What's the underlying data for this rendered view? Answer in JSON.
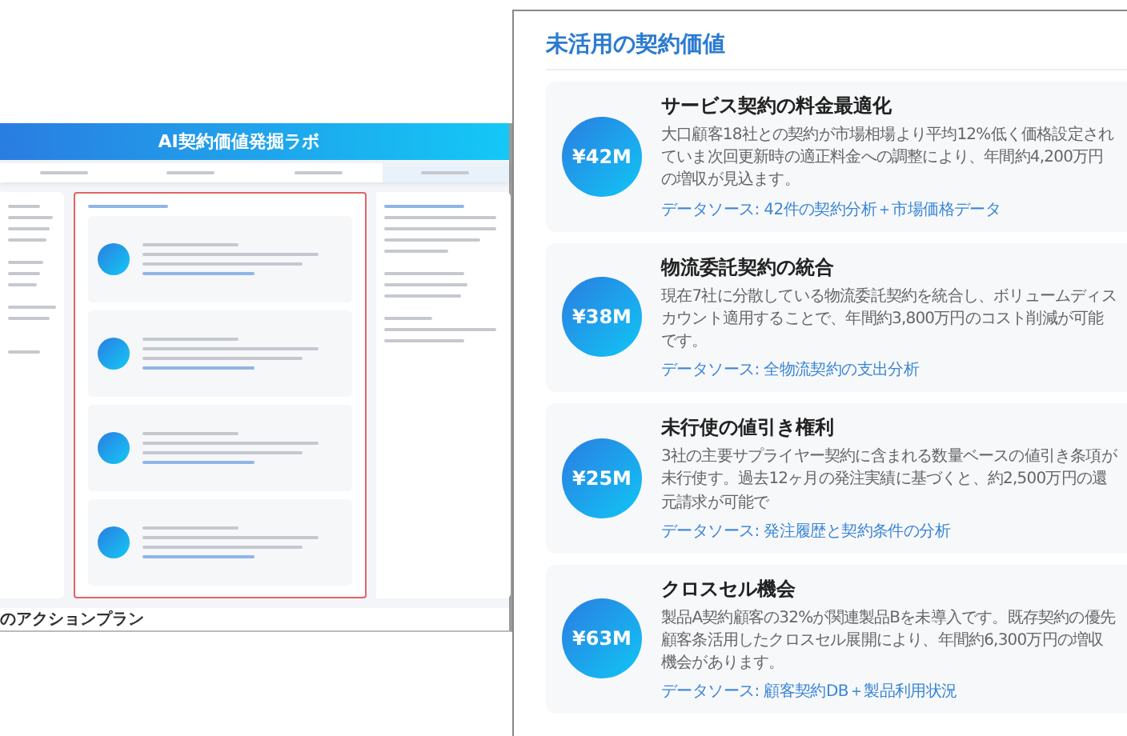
{
  "thumbnail": {
    "title": "AI契約価値発掘ラボ",
    "footer_heading": "のアクションプラン"
  },
  "panel": {
    "heading": "未活用の契約価値",
    "cards": [
      {
        "amount": "¥42M",
        "title": "サービス契約の料金最適化",
        "body": "大口顧客18社との契約が市場相場より平均12%低く価格設定されていま次回更新時の適正料金への調整により、年間約4,200万円の増収が見込ます。",
        "source": "データソース: 42件の契約分析＋市場価格データ"
      },
      {
        "amount": "¥38M",
        "title": "物流委託契約の統合",
        "body": "現在7社に分散している物流委託契約を統合し、ボリュームディスカウント適用することで、年間約3,800万円のコスト削減が可能です。",
        "source": "データソース: 全物流契約の支出分析"
      },
      {
        "amount": "¥25M",
        "title": "未行使の値引き権利",
        "body": "3社の主要サプライヤー契約に含まれる数量ベースの値引き条項が未行使す。過去12ヶ月の発注実績に基づくと、約2,500万円の還元請求が可能で",
        "source": "データソース: 発注履歴と契約条件の分析"
      },
      {
        "amount": "¥63M",
        "title": "クロスセル機会",
        "body": "製品A契約顧客の32%が関連製品Bを未導入です。既存契約の優先顧客条活用したクロスセル展開により、年間約6,300万円の増収機会があります。",
        "source": "データソース: 顧客契約DB＋製品利用状況"
      }
    ]
  }
}
